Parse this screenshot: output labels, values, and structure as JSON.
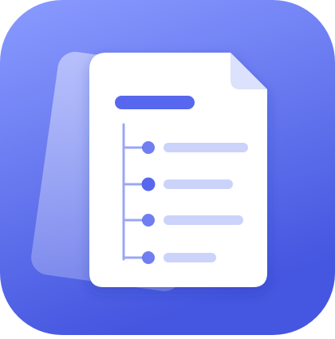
{
  "icon": {
    "kind": "app-icon",
    "depicts": "document-outline",
    "colors": {
      "background_top": "#8A9BFF",
      "background_bottom": "#4556E0",
      "back_sheet": "#C4CCFF",
      "page": "#FFFFFF",
      "page_fold": "#DCE2FB",
      "title_bar": "#5767EE",
      "timeline": "#9AA7F4",
      "bullet": "#5767EE",
      "line_item": "#CBD3FA"
    },
    "outline_item_count": 4,
    "selected_item_index": 1
  }
}
